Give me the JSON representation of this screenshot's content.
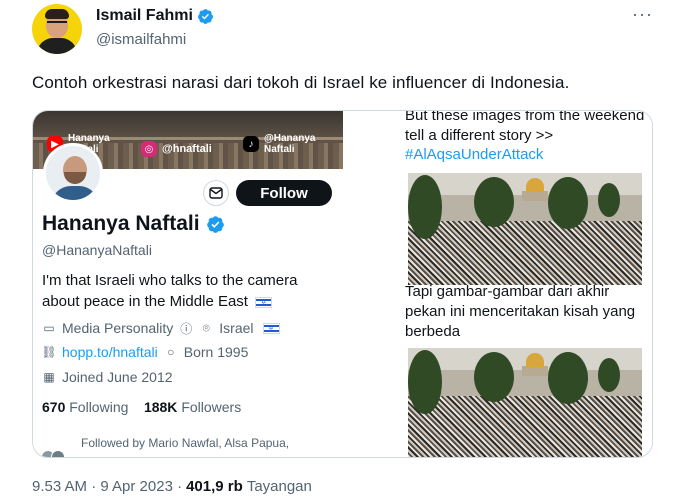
{
  "tweet": {
    "author_name": "Ismail Fahmi",
    "author_handle": "@ismailfahmi",
    "more_label": "···",
    "text": "Contoh orkestrasi narasi dari tokoh di Israel ke influencer di Indonesia.",
    "timestamp": "9.53 AM · 9 Apr 2023 ·",
    "views_count": "401,9 rb",
    "views_label": "Tayangan"
  },
  "embedded_profile": {
    "banner_socials": [
      {
        "icon": "youtube-icon",
        "label_line1": "Hananya",
        "label_line2": "Naftali"
      },
      {
        "icon": "instagram-icon",
        "label_line1": "@hnaftali",
        "label_line2": ""
      },
      {
        "icon": "tiktok-icon",
        "label_line1": "@Hananya",
        "label_line2": "Naftali"
      }
    ],
    "follow_label": "Follow",
    "name": "Hananya Naftali",
    "handle": "@HananyaNaftali",
    "bio_line1": "I'm that Israeli who talks to the camera",
    "bio_line2": "about peace in the Middle East",
    "category": "Media Personality",
    "location": "Israel",
    "link": "hopp.to/hnaftali",
    "born": "Born 1995",
    "joined": "Joined June 2012",
    "following_count": "670",
    "following_label": "Following",
    "followers_count": "188K",
    "followers_label": "Followers",
    "followed_by": "Followed by Mario Nawfal, Alsa Papua,"
  },
  "embedded_post": {
    "text_en": "But these images from the weekend tell a different story >>",
    "hashtag": "#AlAqsaUnderAttack",
    "text_id": "Tapi gambar-gambar dari akhir pekan ini menceritakan kisah yang berbeda"
  },
  "colors": {
    "accent": "#1d9bf0",
    "text": "#0f1419",
    "secondary": "#536471",
    "border": "#cfd9de"
  }
}
